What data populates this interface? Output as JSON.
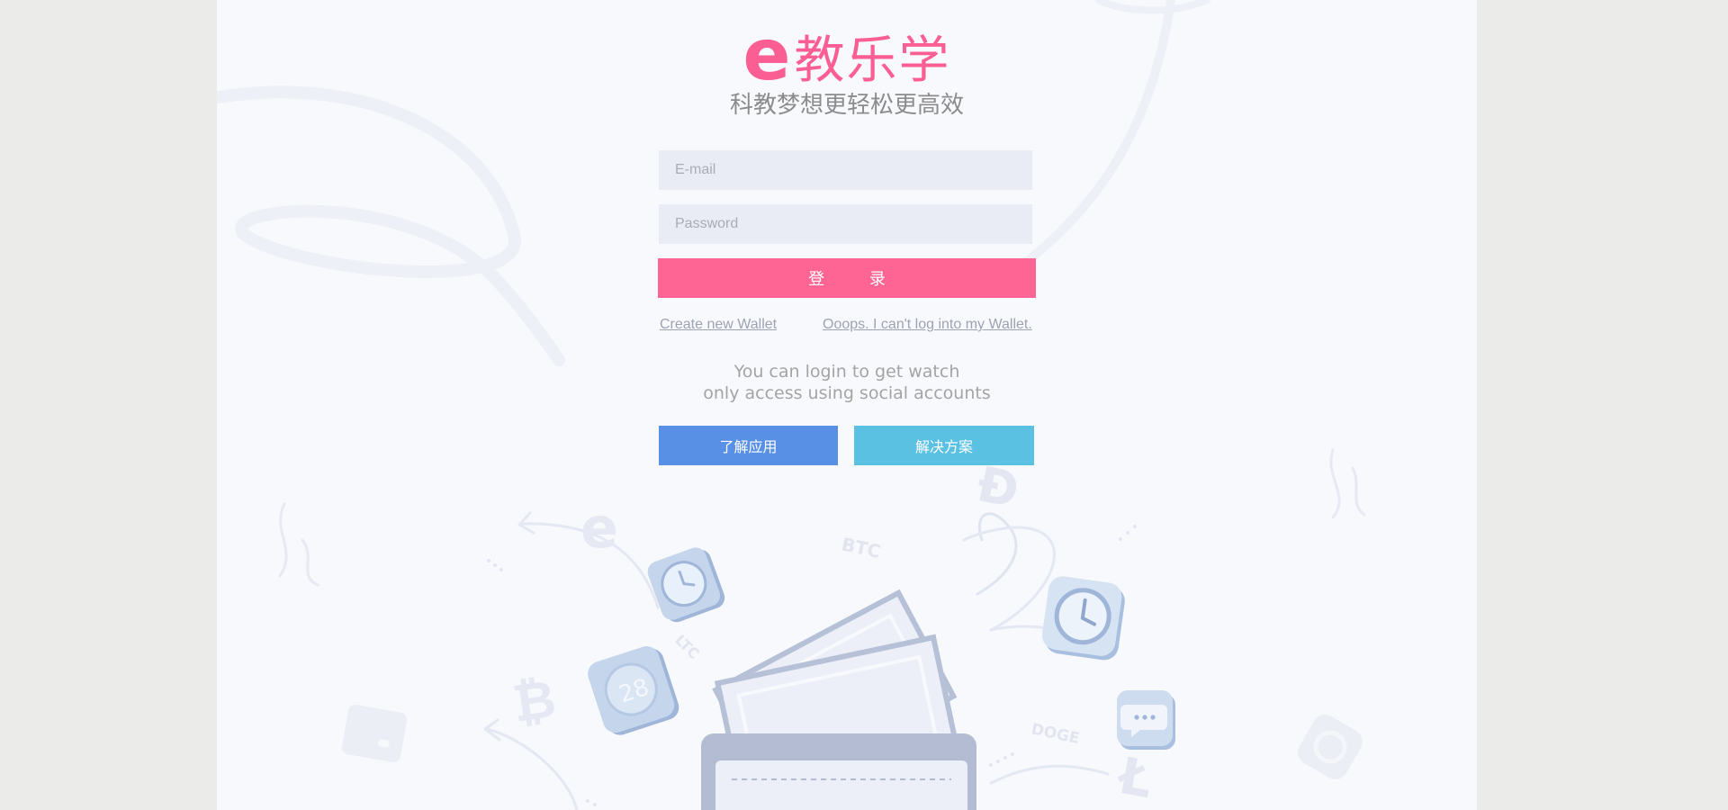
{
  "brand": {
    "logo_letter": "e",
    "logo_name": "教乐学",
    "tagline": "科教梦想更轻松更高效",
    "accent": "#fe6595"
  },
  "form": {
    "email_placeholder": "E-mail",
    "password_placeholder": "Password",
    "login_label": "登 录"
  },
  "links": {
    "create_wallet": "Create new Wallet",
    "recover": "Ooops. I can't log into my Wallet."
  },
  "social": {
    "line1": "You can login to get watch",
    "line2": "only access using social accounts"
  },
  "buttons": {
    "learn": "了解应用",
    "solutions": "解决方案",
    "learn_color": "#5890e5",
    "solutions_color": "#5bc1e3"
  },
  "illustration": {
    "coin_labels": [
      "e",
      "BTC",
      "LTC",
      "DOGE"
    ],
    "badge_number": "28"
  }
}
